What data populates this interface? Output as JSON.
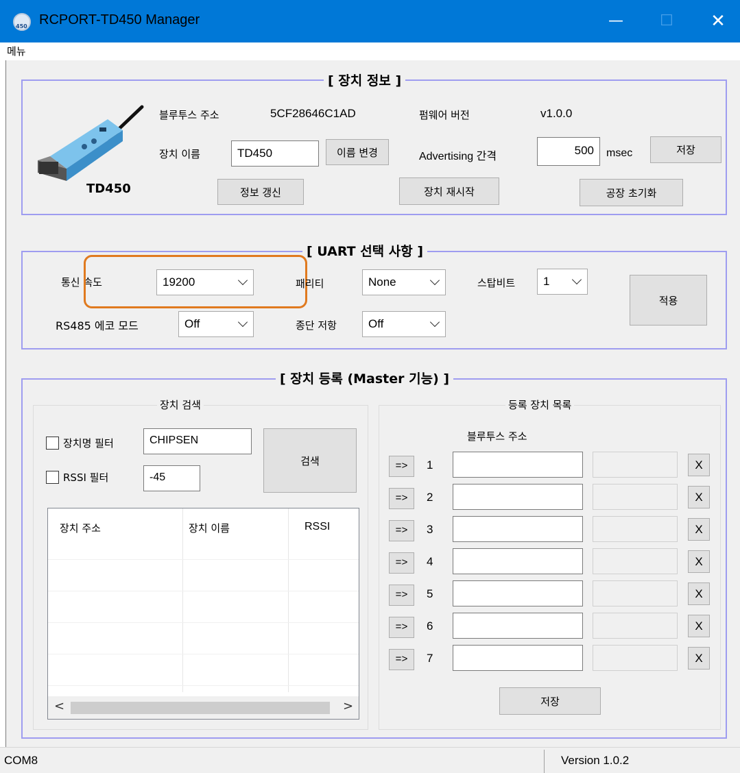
{
  "window": {
    "title": "RCPORT-TD450 Manager",
    "min_glyph": "—",
    "max_glyph": "☐",
    "close_glyph": "✕"
  },
  "menu": {
    "label": "메뉴"
  },
  "device_info": {
    "group_title": "[ 장치 정보 ]",
    "image_label": "TD450",
    "bt_address_label": "블루투스 주소",
    "bt_address_value": "5CF28646C1AD",
    "firmware_label": "펌웨어 버전",
    "firmware_value": "v1.0.0",
    "device_name_label": "장치 이름",
    "device_name_value": "TD450",
    "rename_button": "이름 변경",
    "adv_interval_label": "Advertising 간격",
    "adv_interval_value": "500",
    "adv_unit": "msec",
    "save_button": "저장",
    "refresh_button": "정보 갱신",
    "restart_button": "장치 재시작",
    "factory_reset_button": "공장 초기화"
  },
  "uart": {
    "group_title": "[ UART 선택 사항 ]",
    "baud_label": "통신 속도",
    "baud_value": "19200",
    "parity_label": "패리티",
    "parity_value": "None",
    "stopbit_label": "스탑비트",
    "stopbit_value": "1",
    "apply_button": "적용",
    "echo_label": "RS485 에코 모드",
    "echo_value": "Off",
    "termination_label": "종단 저항",
    "termination_value": "Off",
    "highlight_color": "#e07a1f"
  },
  "register": {
    "group_title_prefix": "[ 장치 등록 (",
    "group_title_bold": "Master",
    "group_title_suffix": " 기능) ]",
    "search_group_title": "장치 검색",
    "name_filter_label": "장치명 필터",
    "name_filter_value": "CHIPSEN",
    "rssi_filter_label": "RSSI 필터",
    "rssi_filter_value": "-45",
    "search_button": "검색",
    "columns": [
      "장치 주소",
      "장치 이름",
      "RSSI"
    ],
    "list_group_title": "등록 장치 목록",
    "bt_address_header": "블루투스 주소",
    "rows": [
      {
        "arrow": "=>",
        "num": "1",
        "remove": "X"
      },
      {
        "arrow": "=>",
        "num": "2",
        "remove": "X"
      },
      {
        "arrow": "=>",
        "num": "3",
        "remove": "X"
      },
      {
        "arrow": "=>",
        "num": "4",
        "remove": "X"
      },
      {
        "arrow": "=>",
        "num": "5",
        "remove": "X"
      },
      {
        "arrow": "=>",
        "num": "6",
        "remove": "X"
      },
      {
        "arrow": "=>",
        "num": "7",
        "remove": "X"
      }
    ],
    "save_button": "저장",
    "scroll_left": "<",
    "scroll_right": ">"
  },
  "status": {
    "port": "COM8",
    "version": "Version 1.0.2"
  }
}
